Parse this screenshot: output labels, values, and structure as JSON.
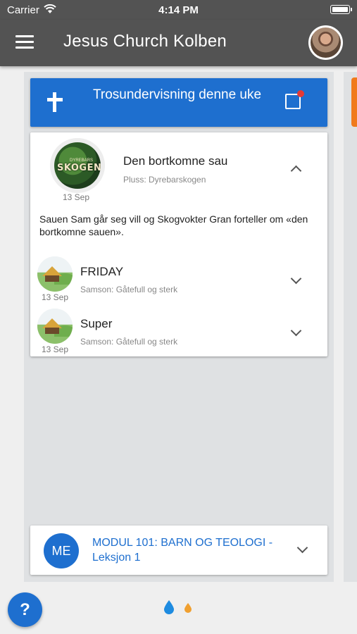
{
  "status_bar": {
    "carrier": "Carrier",
    "time": "4:14 PM"
  },
  "app_bar": {
    "title": "Jesus Church Kolben"
  },
  "section_header": {
    "title": "Trosundervisning denne uke",
    "icon": "cross-icon",
    "has_notification": true,
    "notification_color": "#e53935"
  },
  "lesson": {
    "title": "Den bortkomne sau",
    "subtitle": "Pluss: Dyrebarskogen",
    "date": "13 Sep",
    "thumb_text": "SKOGEN",
    "thumb_small_text": "DYREBARS",
    "description": "Sauen Sam går seg vill og Skogvokter Gran forteller om «den bortkomne sauen».",
    "expanded": true,
    "items": [
      {
        "title": "FRIDAY",
        "subtitle": "Samson: Gåtefull og sterk",
        "date": "13 Sep"
      },
      {
        "title": "Super",
        "subtitle": "Samson: Gåtefull og sterk",
        "date": "13 Sep"
      }
    ]
  },
  "module": {
    "badge": "ME",
    "title": "MODUL 101: BARN OG TEOLOGI - Leksjon 1"
  },
  "bottom": {
    "help_label": "?"
  },
  "colors": {
    "primary": "#1e6fcf",
    "toolbar": "#535353",
    "accent_orange": "#f07a1c"
  }
}
